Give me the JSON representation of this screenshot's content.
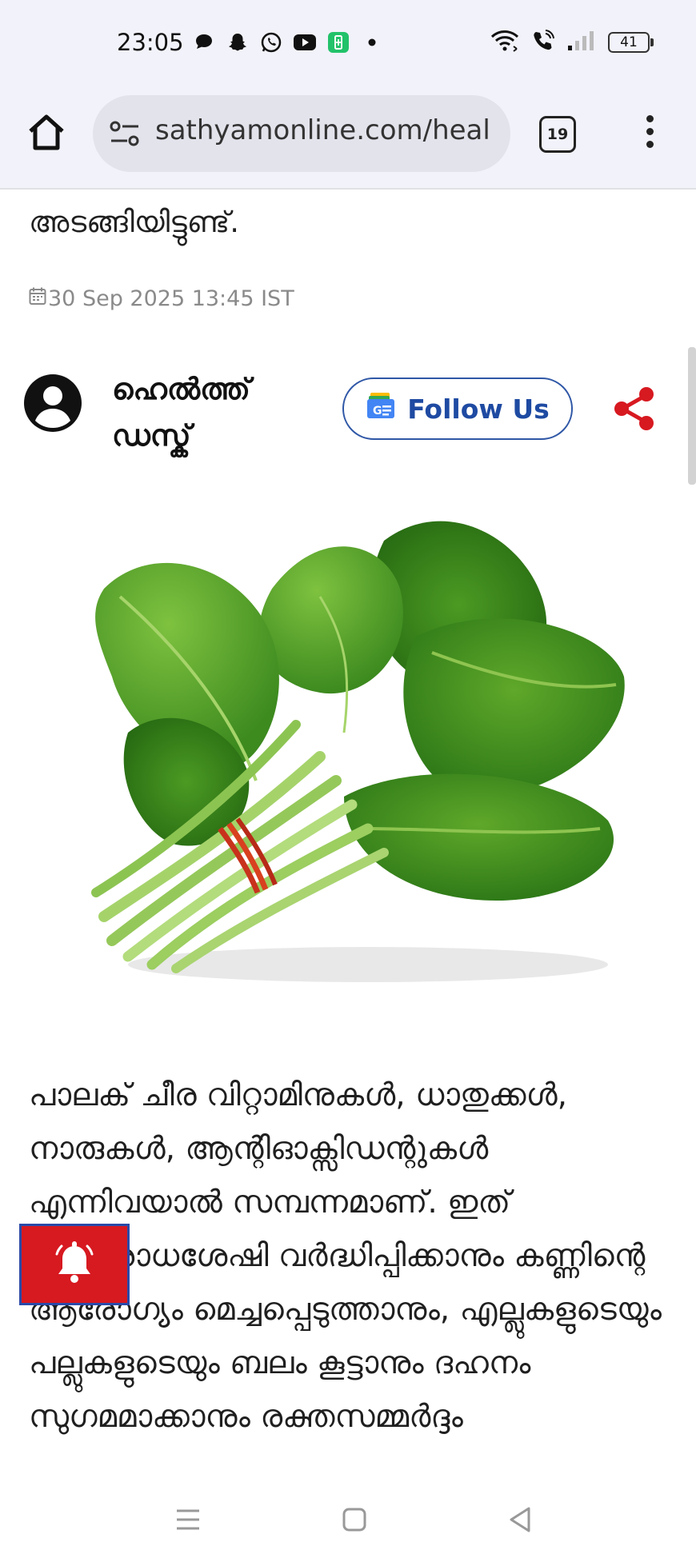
{
  "status_bar": {
    "time": "23:05",
    "app_icons": [
      "chat-bubble-icon",
      "snapchat-icon",
      "whatsapp-icon",
      "youtube-icon",
      "battery-saver-icon",
      "dot-icon"
    ],
    "battery_level": "41"
  },
  "browser": {
    "url": "sathyamonline.com/heal",
    "tab_count": "19"
  },
  "article": {
    "partial_line": "അടങ്ങിയിട്ടുണ്ട്.",
    "date": "30 Sep 2025 13:45 IST",
    "author": "ഹെൽത്ത് ഡസ്ക്",
    "follow_label": "Follow Us",
    "image_alt": "Spinach bunch",
    "body": "പാലക് ചീര വിറ്റാമിനുകൾ, ധാതുക്കൾ, നാരുകൾ, ആന്റിഓക്സിഡന്റുകൾ എന്നിവയാൽ സമ്പന്നമാണ്. ഇത് പ്രതിരോധശേഷി വർദ്ധിപ്പിക്കാനും കണ്ണിന്റെ ആരോഗ്യം മെച്ചപ്പെടുത്താനും, എല്ലുകളുടെയും പല്ലുകളുടെയും ബലം കൂട്ടാനും ദഹനം സുഗമമാക്കാനും രക്തസമ്മർദ്ദം"
  },
  "colors": {
    "accent_red": "#d71920",
    "follow_blue": "#1e4aa2",
    "bar_bg": "#f2f2fa"
  }
}
